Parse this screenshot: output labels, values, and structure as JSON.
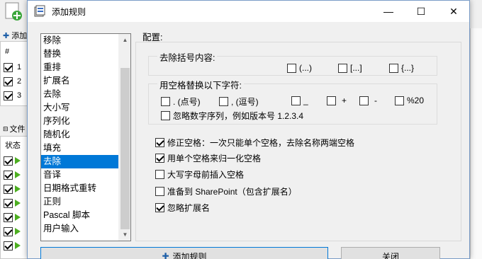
{
  "background_window": {
    "add_label": "添加",
    "hash_header": "#",
    "rows": [
      {
        "num": "1",
        "checked": true
      },
      {
        "num": "2",
        "checked": true
      },
      {
        "num": "3",
        "checked": true
      }
    ],
    "files_label": "文件",
    "status_header": "状态"
  },
  "dialog": {
    "title": "添加规则",
    "window_buttons": {
      "minimize": "—",
      "maximize": "☐",
      "close": "✕"
    },
    "rules": [
      "移除",
      "替换",
      "重排",
      "扩展名",
      "去除",
      "大小写",
      "序列化",
      "随机化",
      "填充",
      "去除",
      "音译",
      "日期格式重转",
      "正则",
      "Pascal 脚本",
      "用户输入"
    ],
    "selected_rule_index": 9,
    "config_label": "配置:",
    "brackets_group": {
      "title": "去除括号内容:",
      "options": [
        {
          "label": "(...)",
          "checked": false
        },
        {
          "label": "[...]",
          "checked": false
        },
        {
          "label": "{...}",
          "checked": false
        }
      ]
    },
    "replace_group": {
      "title": "用空格替换以下字符:",
      "options": [
        {
          "label": ". (点号)",
          "checked": false
        },
        {
          "label": ", (逗号)",
          "checked": false
        },
        {
          "label": "_",
          "checked": false
        },
        {
          "label": "+",
          "checked": false
        },
        {
          "label": "-",
          "checked": false
        },
        {
          "label": "%20",
          "checked": false
        }
      ],
      "ignore_numeric": {
        "label": "忽略数字序列，例如版本号 1.2.3.4",
        "checked": false
      }
    },
    "options": [
      {
        "label": "修正空格：一次只能单个空格，去除名称两端空格",
        "checked": true
      },
      {
        "label": "用单个空格来归一化空格",
        "checked": true
      },
      {
        "label": "大写字母前插入空格",
        "checked": false
      },
      {
        "label": "准备到 SharePoint（包含扩展名）",
        "checked": false
      },
      {
        "label": "忽略扩展名",
        "checked": true
      }
    ],
    "add_rule_button": "添加规则",
    "close_button": "关闭"
  }
}
